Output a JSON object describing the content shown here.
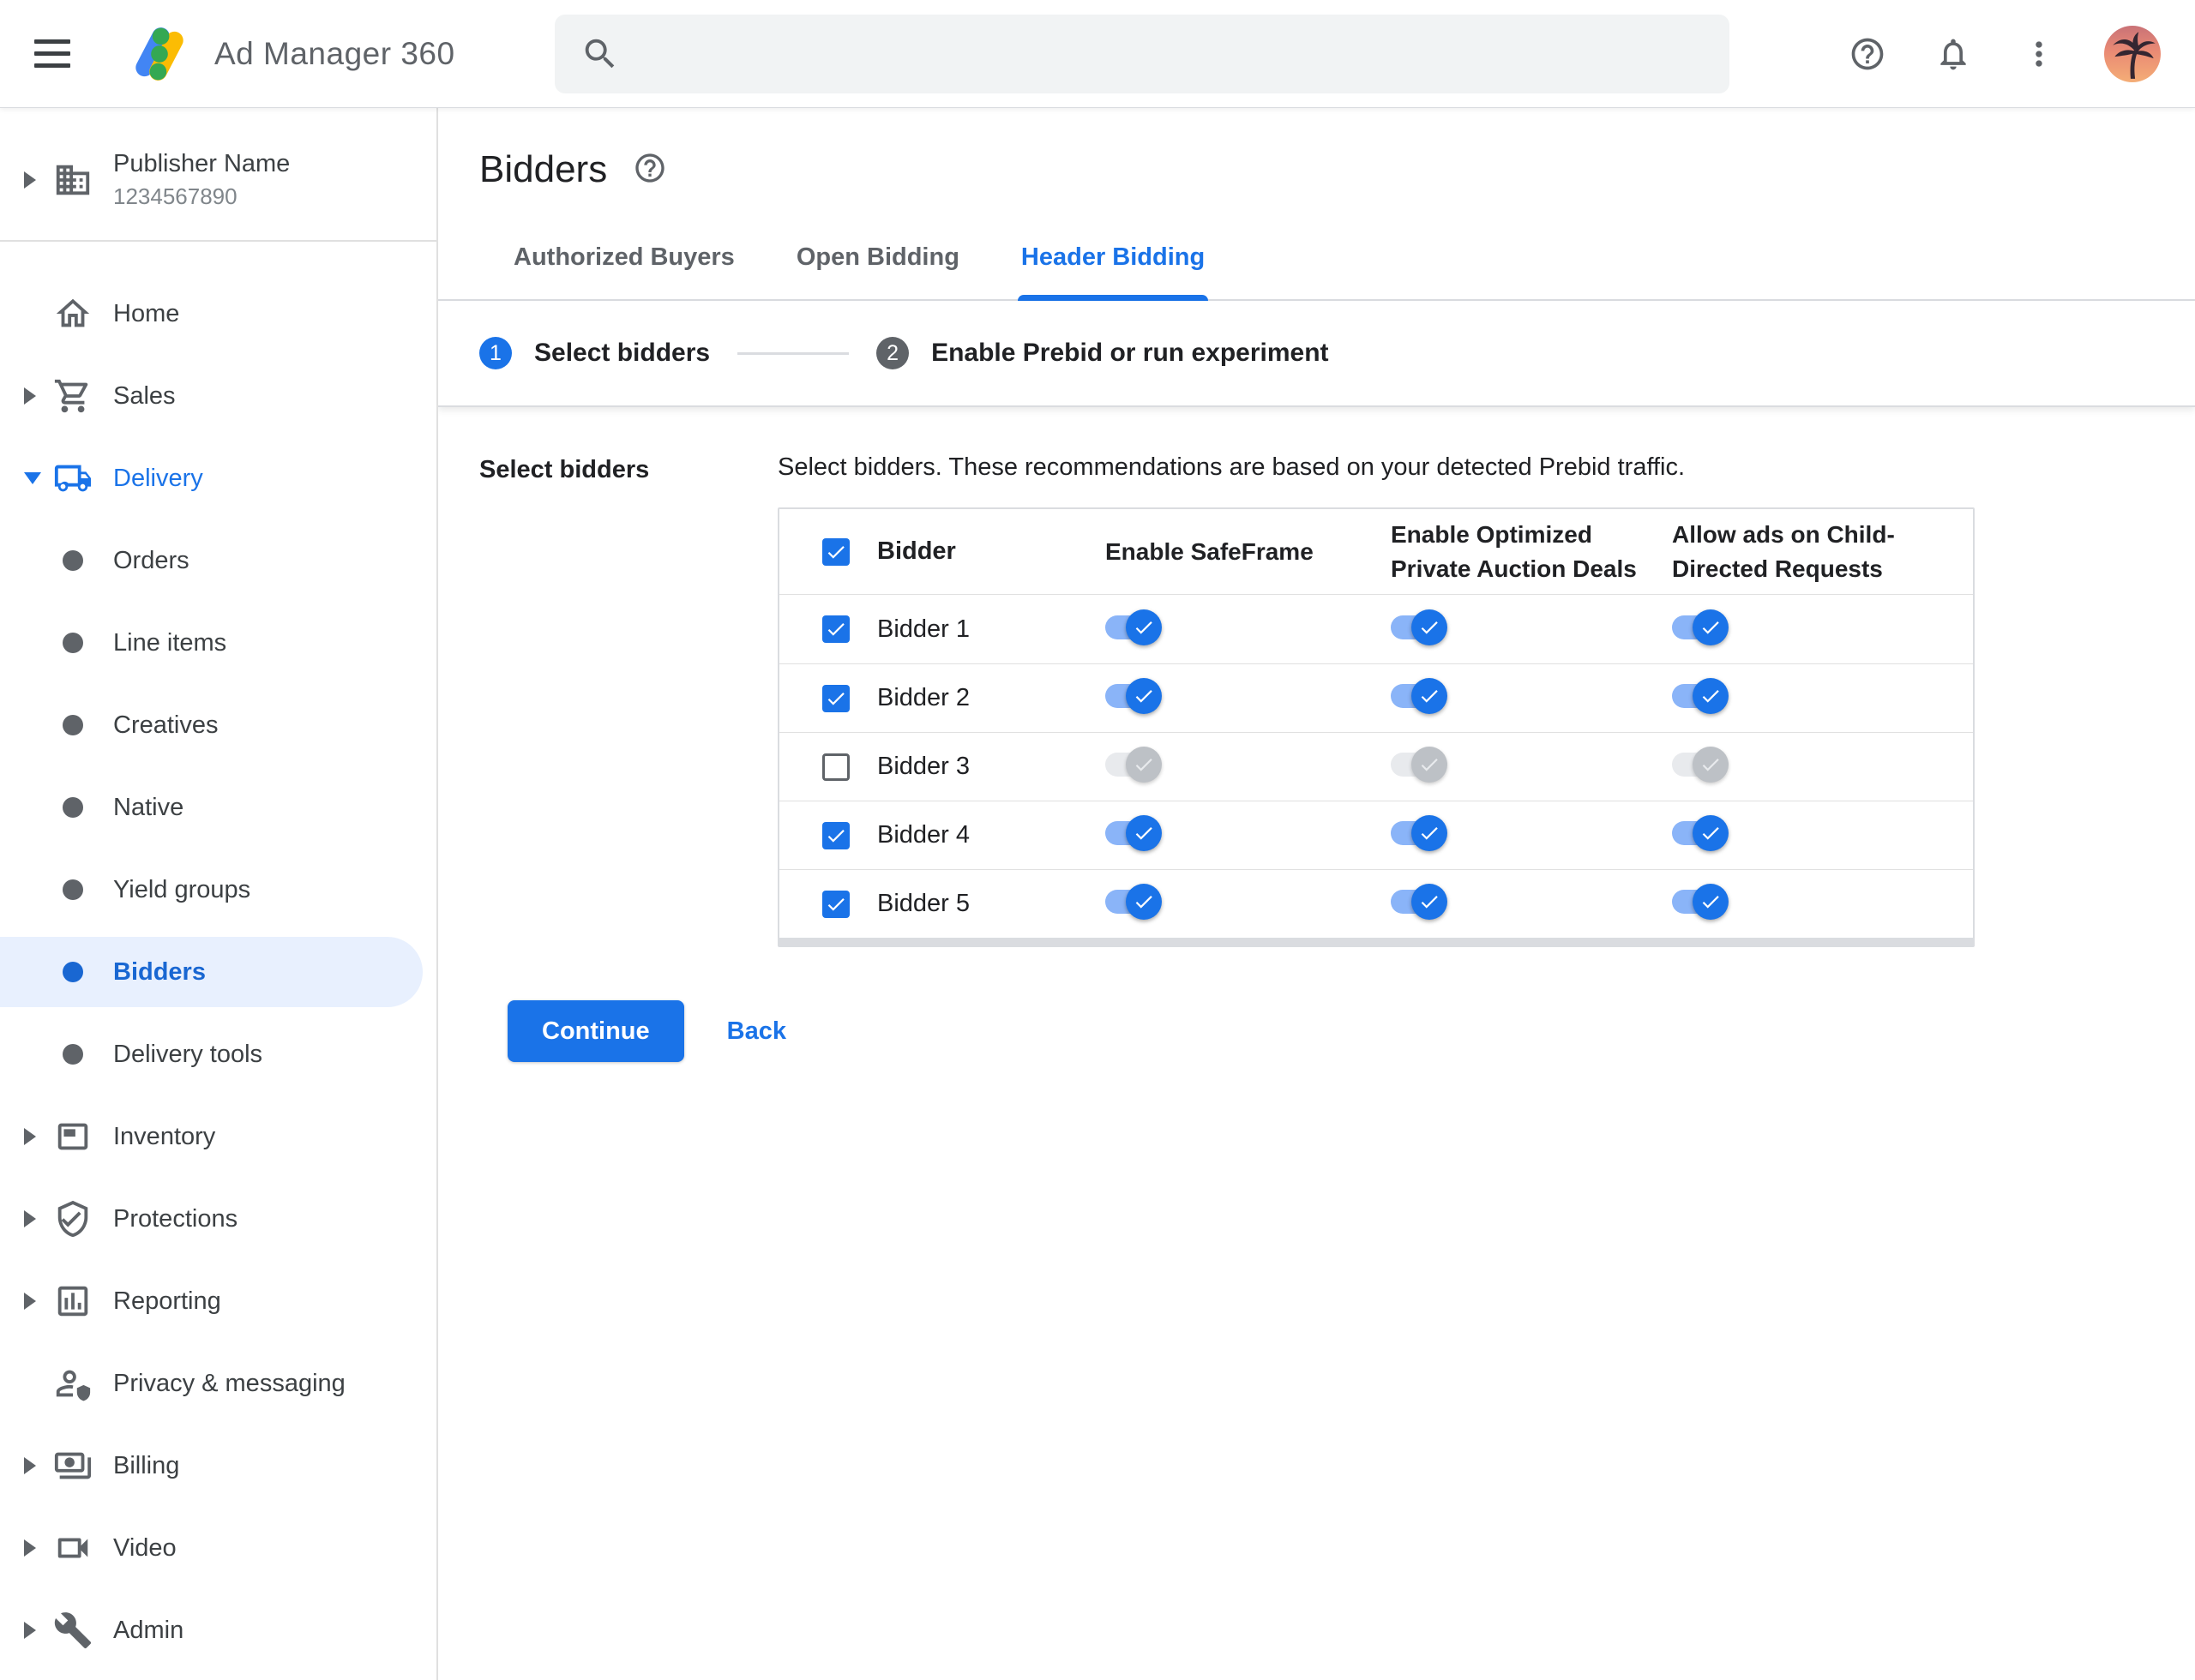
{
  "header": {
    "app_name": "Ad Manager 360",
    "search": {
      "placeholder": ""
    },
    "icons": [
      "menu-icon",
      "ad-manager-logo",
      "search-icon",
      "help-icon",
      "bell-icon",
      "more-vertical-icon",
      "avatar-palm-tree"
    ]
  },
  "sidebar": {
    "publisher": {
      "name": "Publisher Name",
      "id": "1234567890"
    },
    "items": [
      {
        "label": "Home",
        "icon": "home-icon"
      },
      {
        "label": "Sales",
        "icon": "cart-icon",
        "collapsed": true
      },
      {
        "label": "Delivery",
        "icon": "truck-icon",
        "expanded": true,
        "highlight": true
      },
      {
        "label": "Orders",
        "type": "sub"
      },
      {
        "label": "Line items",
        "type": "sub"
      },
      {
        "label": "Creatives",
        "type": "sub"
      },
      {
        "label": "Native",
        "type": "sub"
      },
      {
        "label": "Yield groups",
        "type": "sub"
      },
      {
        "label": "Bidders",
        "type": "sub",
        "selected": true
      },
      {
        "label": "Delivery tools",
        "type": "sub"
      },
      {
        "label": "Inventory",
        "icon": "inventory-icon",
        "collapsed": true
      },
      {
        "label": "Protections",
        "icon": "shield-check-icon",
        "collapsed": true
      },
      {
        "label": "Reporting",
        "icon": "bar-chart-icon",
        "collapsed": true
      },
      {
        "label": "Privacy & messaging",
        "icon": "person-shield-icon"
      },
      {
        "label": "Billing",
        "icon": "payments-icon",
        "collapsed": true
      },
      {
        "label": "Video",
        "icon": "videocam-icon",
        "collapsed": true
      },
      {
        "label": "Admin",
        "icon": "wrench-icon",
        "collapsed": true
      }
    ]
  },
  "page": {
    "title": "Bidders",
    "tabs": [
      {
        "label": "Authorized Buyers",
        "active": false
      },
      {
        "label": "Open Bidding",
        "active": false
      },
      {
        "label": "Header Bidding",
        "active": true
      }
    ],
    "stepper": [
      {
        "number": "1",
        "label": "Select bidders",
        "active": true
      },
      {
        "number": "2",
        "label": "Enable Prebid or run experiment",
        "active": false
      }
    ],
    "section_label": "Select bidders",
    "description": "Select bidders. These recommendations are based on your detected Prebid traffic.",
    "table": {
      "header_checkbox_checked": true,
      "columns": [
        "Bidder",
        "Enable SafeFrame",
        "Enable Optimized Private Auction Deals",
        "Allow ads on Child-Directed Requests"
      ],
      "rows": [
        {
          "name": "Bidder 1",
          "checked": true,
          "safeframe": true,
          "optimized": true,
          "child_directed": true
        },
        {
          "name": "Bidder 2",
          "checked": true,
          "safeframe": true,
          "optimized": true,
          "child_directed": true
        },
        {
          "name": "Bidder 3",
          "checked": false,
          "safeframe": false,
          "optimized": false,
          "child_directed": false
        },
        {
          "name": "Bidder 4",
          "checked": true,
          "safeframe": true,
          "optimized": true,
          "child_directed": true
        },
        {
          "name": "Bidder 5",
          "checked": true,
          "safeframe": true,
          "optimized": true,
          "child_directed": true
        }
      ]
    },
    "buttons": {
      "continue": "Continue",
      "back": "Back"
    }
  },
  "colors": {
    "accent": "#1a73e8",
    "accent_dark": "#1967d2",
    "selected_pill": "#e8f0fe",
    "toggle_track_on": "#8ab4f8",
    "toggle_thumb_on": "#1a73e8",
    "toggle_track_off": "#e8eaed",
    "toggle_thumb_off": "#bdc1c6",
    "divider": "#dadce0",
    "text_primary": "#202124",
    "text_secondary": "#5f6368",
    "search_bg": "#f1f3f4",
    "logo_blue": "#4285f4",
    "logo_yellow": "#fbbc04",
    "logo_green": "#34a853"
  }
}
